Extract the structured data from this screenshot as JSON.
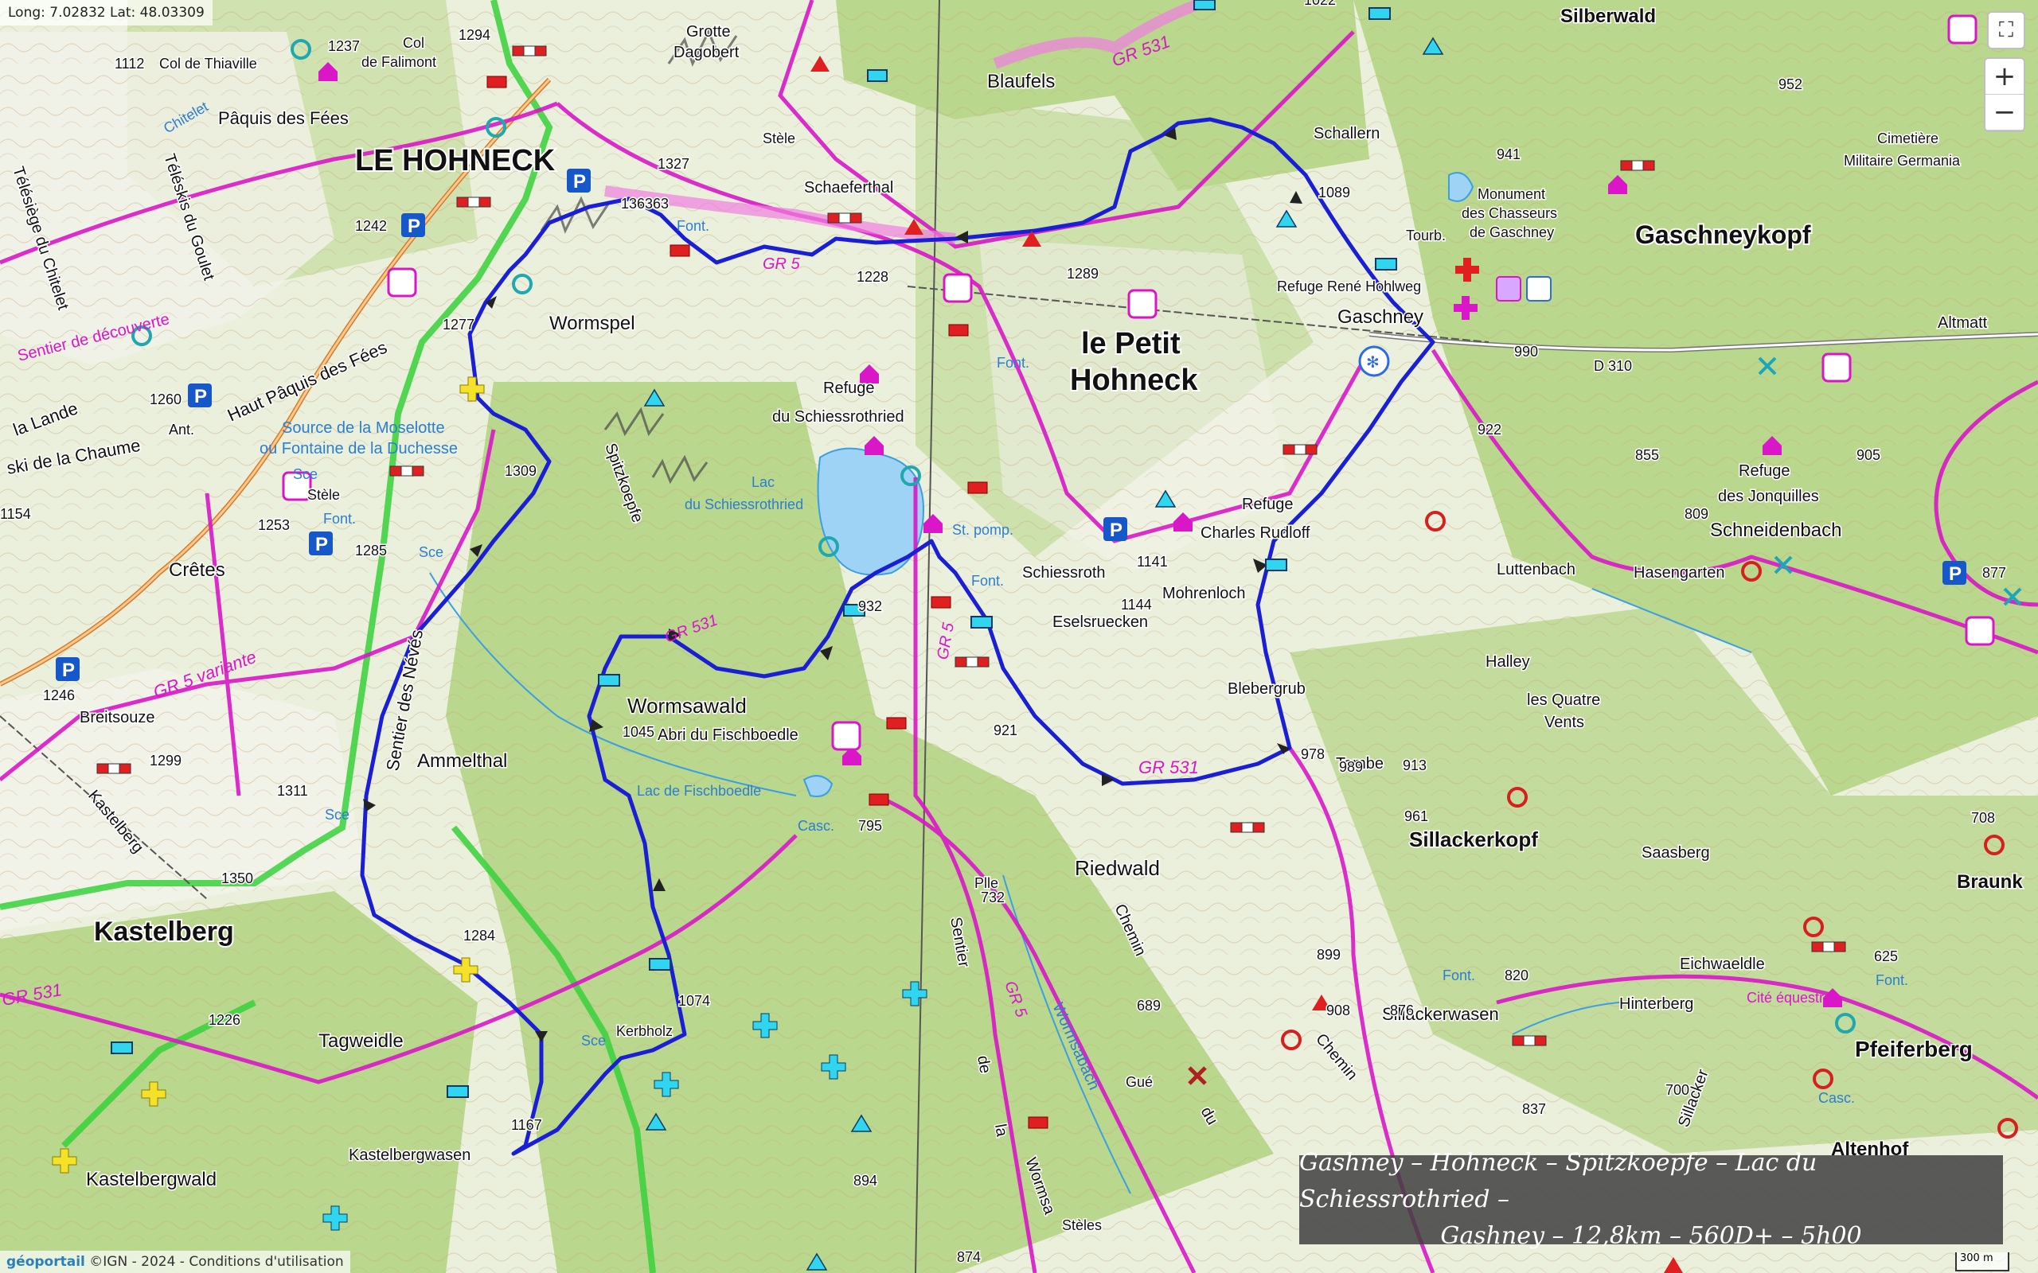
{
  "coords": "Long: 7.02832 Lat: 48.03309",
  "controls": {
    "zoom_in": "+",
    "zoom_out": "−",
    "fullscreen": "⛶"
  },
  "title": {
    "line1": "Gashney – Hohneck – Spitzkoepfe – Lac du Schiessrothried –",
    "line2": "Gashney – 12,8km – 560D+ – 5h00"
  },
  "attribution": {
    "brand": "géoportail",
    "text": " ©IGN - 2024 - Conditions d'utilisation"
  },
  "scale": "300 m",
  "colors": {
    "route": "#1a1fd6",
    "trail": "#d917c8",
    "forest": "#b8d68a",
    "water": "#9fd3f5",
    "border": "#37d13a"
  },
  "labels": {
    "le_hohneck": "LE HOHNECK",
    "le_petit_hohneck_1": "le Petit",
    "le_petit_hohneck_2": "Hohneck",
    "gaschneykopf": "Gaschneykopf",
    "kastelberg": "Kastelberg",
    "kastelberg_small": "Kastelberg",
    "wormspel": "Wormspel",
    "wormsawald": "Wormsawald",
    "ammelthal": "Ammelthal",
    "tagweidle": "Tagweidle",
    "kastelbergwald": "Kastelbergwald",
    "kastelbergwasen": "Kastelbergwasen",
    "riedwald": "Riedwald",
    "sillackerkopf": "Sillackerkopf",
    "sillackerwasen": "Sillackerwasen",
    "pfeiferberg": "Pfeiferberg",
    "altenhof": "Altenhof",
    "silberwald": "Silberwald",
    "schallern": "Schallern",
    "blaufels": "Blaufels",
    "schaeferthal": "Schaeferthal",
    "grotte_dagobert_1": "Grotte",
    "grotte_dagobert_2": "Dagobert",
    "paquis_des_fees": "Pâquis des Fées",
    "haut_paquis_des_fees": "Haut Pâquis des Fées",
    "col_de_thiaville": "Col de Thiaville",
    "col_de_falimont_1": "Col",
    "col_de_falimont_2": "de Falimont",
    "refuge_schiessrothried_1": "Refuge",
    "refuge_schiessrothried_2": "du Schiessrothried",
    "lac_schiessrothried_1": "Lac",
    "lac_schiessrothried_2": "du Schiessrothried",
    "refuge_rene_hohlweg": "Refuge René Hohlweg",
    "gaschney": "Gaschney",
    "monument_1": "Monument",
    "monument_2": "des Chasseurs",
    "monument_3": "de Gaschney",
    "refuge_charles_rudloff_1": "Refuge",
    "refuge_charles_rudloff_2": "Charles Rudloff",
    "schiessroth": "Schiessroth",
    "mohrenloch": "Mohrenloch",
    "eselsruecken": "Eselsruecken",
    "blebergrub": "Blebergrub",
    "abri_fischboedle": "Abri du Fischboedle",
    "lac_fischboedle": "Lac de Fischboedle",
    "spitzkoepfe": "Spitzkoepfe",
    "sentier_des_neves": "Sentier des Névés",
    "source_moselotte_1": "Source de la Moselotte",
    "source_moselotte_2": "ou Fontaine de la Duchesse",
    "cretes": "Crêtes",
    "breitsouze": "Breitsouze",
    "luttenbach": "Luttenbach",
    "hasengarten": "Hasengarten",
    "schneidenbach": "Schneidenbach",
    "refuge_jonquilles_1": "Refuge",
    "refuge_jonquilles_2": "des Jonquilles",
    "halley": "Halley",
    "quatre_vents_1": "les Quatre",
    "quatre_vents_2": "Vents",
    "saasberg": "Saasberg",
    "eichwaeldle": "Eichwaeldle",
    "hinterberg": "Hinterberg",
    "cite_equestre": "Cité équestre",
    "tombe": "Tombe",
    "cimetiere_1": "Cimetière",
    "cimetiere_2": "Militaire Germania",
    "altmatt": "Altmatt",
    "braunk": "Braunk",
    "stele": "Stèle",
    "font": "Font.",
    "sce": "Sce",
    "tourb": "Tourb.",
    "ant": "Ant.",
    "casc": "Casc.",
    "st_pomp": "St. pomp.",
    "kerbholz": "Kerbholz",
    "gue": "Gué",
    "steles": "Stèles",
    "pile": "Plle",
    "la_lande": "la Lande",
    "ski_chaume": "ski de la Chaume",
    "telesiege": "Télésiège du Chitelet",
    "teleskis": "Téléskis du Goulet",
    "chitelet": "Chitelet",
    "sentier_decouverte": "Sentier de découverte",
    "d310": "D 310",
    "gr5": "GR 5",
    "gr531": "GR 531",
    "gr5_variante": "GR 5 variante",
    "chemin": "Chemin",
    "chemin_du": "du",
    "wormsabach": "Wormsabach",
    "sentier_de_la_wormsa_1": "Sentier",
    "sentier_de_la_wormsa_2": "de",
    "sentier_de_la_wormsa_3": "la",
    "sentier_de_la_wormsa_4": "Wormsa",
    "stele_1": "Stèle",
    "sillacker": "Sillacker"
  },
  "elevations": [
    "1294",
    "1237",
    "1112",
    "1327",
    "1363",
    "1242",
    "1277",
    "1260",
    "1309",
    "1253",
    "1154",
    "1285",
    "1246",
    "1299",
    "1311",
    "1350",
    "1284",
    "1226",
    "1167",
    "1228",
    "1289",
    "1022",
    "952",
    "941",
    "1089",
    "990",
    "922",
    "855",
    "905",
    "809",
    "877",
    "1141",
    "1144",
    "932",
    "921",
    "978",
    "989",
    "913",
    "961",
    "1045",
    "1074",
    "795",
    "732",
    "689",
    "899",
    "908",
    "876",
    "820",
    "837",
    "894",
    "874",
    "625",
    "700",
    "708",
    "1363"
  ]
}
